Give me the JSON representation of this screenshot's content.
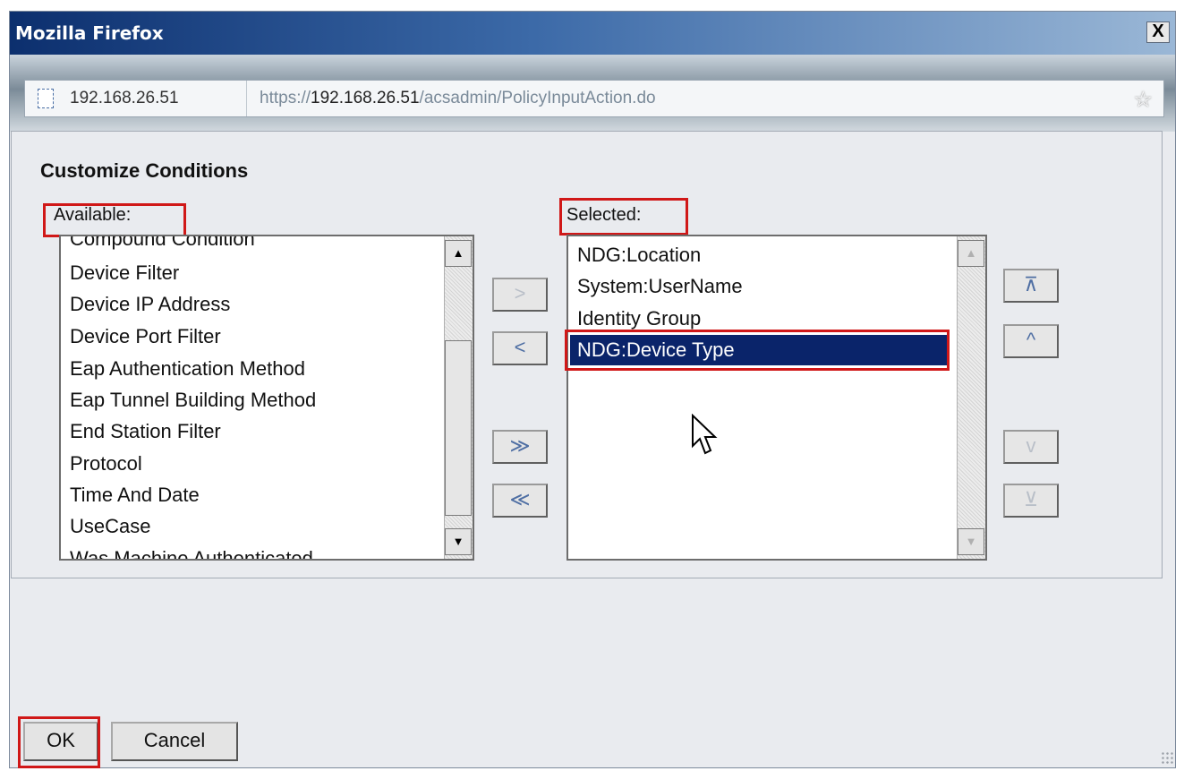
{
  "window": {
    "title": "Mozilla Firefox",
    "close_label": "X"
  },
  "addressbar": {
    "site_identity": "192.168.26.51",
    "url_prefix": "https://",
    "url_host": "192.168.26.51",
    "url_path": "/acsadmin/PolicyInputAction.do"
  },
  "dialog": {
    "heading": "Customize Conditions",
    "available_label": "Available:",
    "selected_label": "Selected:",
    "available_items": [
      "Compound Condition",
      "Device Filter",
      "Device IP Address",
      "Device Port Filter",
      "Eap Authentication Method",
      "Eap Tunnel Building Method",
      "End Station Filter",
      "Protocol",
      "Time And Date",
      "UseCase",
      "Was Machine Authenticated"
    ],
    "selected_items": [
      "NDG:Location",
      "System:UserName",
      "Identity Group",
      "NDG:Device Type"
    ],
    "selected_index": 3,
    "move_buttons": {
      "add": ">",
      "remove": "<",
      "add_all": "≫",
      "remove_all": "≪"
    },
    "order_buttons": {
      "top": "⊼",
      "up": "^",
      "down": "v",
      "bottom": "⊻"
    }
  },
  "footer": {
    "ok_label": "OK",
    "cancel_label": "Cancel"
  },
  "colors": {
    "highlight": "#0a246a",
    "annotation": "#d01818"
  },
  "icons": [
    "page-icon",
    "bookmark-star-icon",
    "mouse-cursor-icon",
    "resize-grip-icon"
  ]
}
